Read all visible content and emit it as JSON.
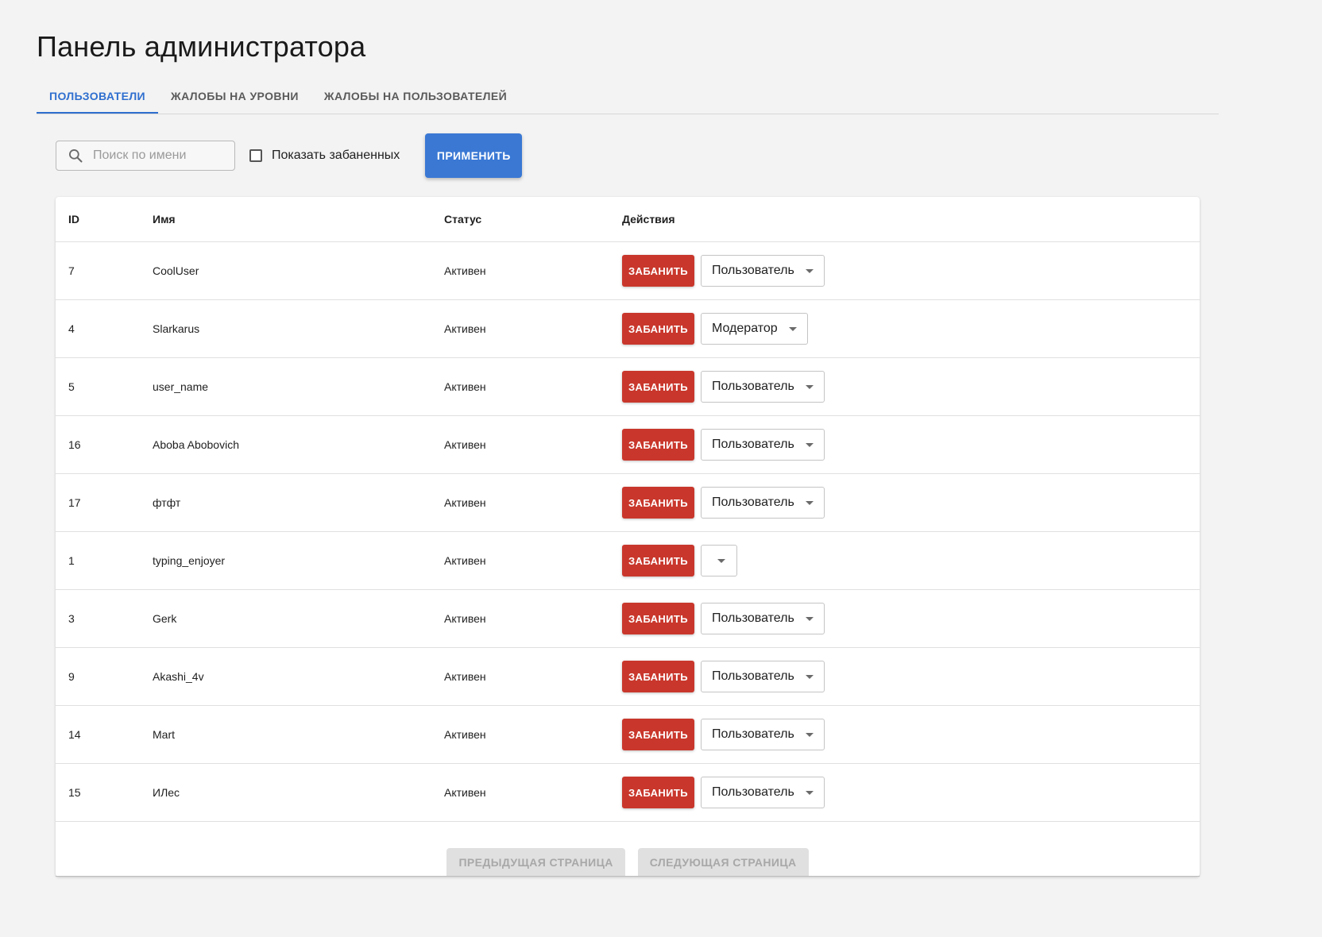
{
  "header": {
    "title": "Панель администратора"
  },
  "tabs": [
    {
      "label": "ПОЛЬЗОВАТЕЛИ",
      "active": true
    },
    {
      "label": "ЖАЛОБЫ НА УРОВНИ",
      "active": false
    },
    {
      "label": "ЖАЛОБЫ НА ПОЛЬЗОВАТЕЛЕЙ",
      "active": false
    }
  ],
  "filters": {
    "search_placeholder": "Поиск по имени",
    "search_value": "",
    "show_banned_label": "Показать забаненных",
    "show_banned_checked": false,
    "apply_label": "ПРИМЕНИТЬ"
  },
  "table": {
    "columns": [
      "ID",
      "Имя",
      "Статус",
      "Действия"
    ],
    "ban_label": "ЗАБАНИТЬ",
    "rows": [
      {
        "id": "7",
        "name": "CoolUser",
        "status": "Активен",
        "role": "Пользователь"
      },
      {
        "id": "4",
        "name": "Slarkarus",
        "status": "Активен",
        "role": "Модератор"
      },
      {
        "id": "5",
        "name": "user_name",
        "status": "Активен",
        "role": "Пользователь"
      },
      {
        "id": "16",
        "name": "Aboba Abobovich",
        "status": "Активен",
        "role": "Пользователь"
      },
      {
        "id": "17",
        "name": "фтфт",
        "status": "Активен",
        "role": "Пользователь"
      },
      {
        "id": "1",
        "name": "typing_enjoyer",
        "status": "Активен",
        "role": ""
      },
      {
        "id": "3",
        "name": "Gerk",
        "status": "Активен",
        "role": "Пользователь"
      },
      {
        "id": "9",
        "name": "Akashi_4v",
        "status": "Активен",
        "role": "Пользователь"
      },
      {
        "id": "14",
        "name": "Mart",
        "status": "Активен",
        "role": "Пользователь"
      },
      {
        "id": "15",
        "name": "ИЛес",
        "status": "Активен",
        "role": "Пользователь"
      }
    ]
  },
  "pagination": {
    "prev_label": "ПРЕДЫДУЩАЯ СТРАНИЦА",
    "next_label": "СЛЕДУЮЩАЯ СТРАНИЦА",
    "prev_disabled": true,
    "next_disabled": true
  },
  "colors": {
    "accent": "#2f6fcf",
    "primary_button": "#3a78d4",
    "danger_button": "#c9372c",
    "background": "#f3f3f3"
  }
}
